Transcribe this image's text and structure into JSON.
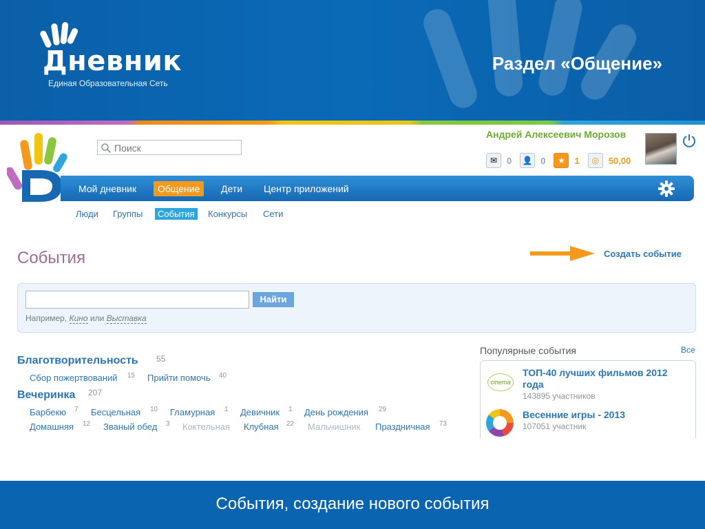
{
  "slide": {
    "logo_name": "Дневник",
    "logo_subtitle": "Единая Образовательная Сеть",
    "title": "Раздел «Общение»",
    "footer": "События, создание нового события"
  },
  "header": {
    "search_placeholder": "Поиск",
    "user_name": "Андрей Алексеевич Морозов",
    "counters": [
      {
        "icon": "mail-icon",
        "value": "0"
      },
      {
        "icon": "friends-icon",
        "value": "0"
      },
      {
        "icon": "notifications-icon",
        "value": "1"
      },
      {
        "icon": "coins-icon",
        "value": "50,00"
      }
    ]
  },
  "nav": {
    "items": [
      "Мой дневник",
      "Общение",
      "Дети",
      "Центр приложений"
    ],
    "active": "Общение"
  },
  "subnav": {
    "items": [
      "Люди",
      "Группы",
      "События",
      "Конкурсы",
      "Сети"
    ],
    "active": "События"
  },
  "main": {
    "title": "События",
    "create_label": "Создать событие",
    "search_button": "Найти",
    "hint_prefix": "Например,",
    "hint_example_1": "Кино",
    "hint_or": "или",
    "hint_example_2": "Выставка"
  },
  "categories": [
    {
      "name": "Благотворительность",
      "count": "55",
      "tags": [
        {
          "label": "Сбор пожертвований",
          "count": "15"
        },
        {
          "label": "Прийти помочь",
          "count": "40"
        }
      ]
    },
    {
      "name": "Вечеринка",
      "count": "207",
      "tags": [
        {
          "label": "Барбекю",
          "count": "7"
        },
        {
          "label": "Бесцельная",
          "count": "10"
        },
        {
          "label": "Гламурная",
          "count": "1"
        },
        {
          "label": "Девичник",
          "count": "1"
        },
        {
          "label": "День рождения",
          "count": "29"
        },
        {
          "label": "Домашняя",
          "count": "12"
        },
        {
          "label": "Званый обед",
          "count": "3"
        },
        {
          "label": "Коктельная",
          "count": ""
        },
        {
          "label": "Клубная",
          "count": "22"
        },
        {
          "label": "Мальчишник",
          "count": ""
        },
        {
          "label": "Праздничная",
          "count": "73"
        }
      ]
    }
  ],
  "popular": {
    "title": "Популярные события",
    "all_label": "Все",
    "items": [
      {
        "logo": "cinema",
        "title": "ТОП-40 лучших фильмов 2012 года",
        "participants": "143895 участников"
      },
      {
        "logo": "spring",
        "title": "Весенние игры - 2013",
        "participants": "107051 участник"
      }
    ]
  },
  "colors": {
    "brand_blue": "#0a64b0",
    "accent_orange": "#f39a1e",
    "link_blue": "#2a75b7",
    "user_green": "#6bab2f",
    "title_purple": "#a06a9b"
  }
}
